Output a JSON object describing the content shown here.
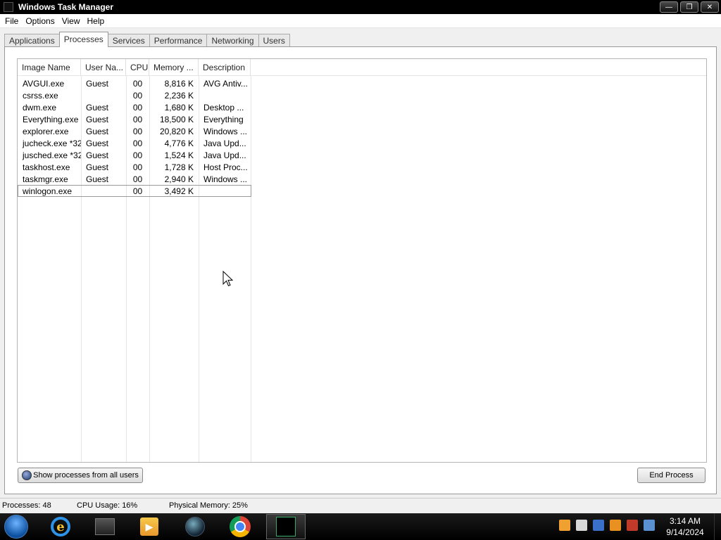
{
  "window": {
    "title": "Windows Task Manager",
    "controls": {
      "minimize": "—",
      "restore": "❐",
      "close": "✕"
    }
  },
  "menu": [
    "File",
    "Options",
    "View",
    "Help"
  ],
  "tabs": [
    {
      "label": "Applications",
      "active": false
    },
    {
      "label": "Processes",
      "active": true
    },
    {
      "label": "Services",
      "active": false
    },
    {
      "label": "Performance",
      "active": false
    },
    {
      "label": "Networking",
      "active": false
    },
    {
      "label": "Users",
      "active": false
    }
  ],
  "table": {
    "columns": [
      "Image Name",
      "User Na...",
      "CPU",
      "Memory ...",
      "Description"
    ],
    "rows": [
      {
        "image": "AVGUI.exe",
        "user": "Guest",
        "cpu": "00",
        "memory": "8,816 K",
        "description": "AVG Antiv..."
      },
      {
        "image": "csrss.exe",
        "user": "",
        "cpu": "00",
        "memory": "2,236 K",
        "description": ""
      },
      {
        "image": "dwm.exe",
        "user": "Guest",
        "cpu": "00",
        "memory": "1,680 K",
        "description": "Desktop ..."
      },
      {
        "image": "Everything.exe",
        "user": "Guest",
        "cpu": "00",
        "memory": "18,500 K",
        "description": "Everything"
      },
      {
        "image": "explorer.exe",
        "user": "Guest",
        "cpu": "00",
        "memory": "20,820 K",
        "description": "Windows ..."
      },
      {
        "image": "jucheck.exe *32",
        "user": "Guest",
        "cpu": "00",
        "memory": "4,776 K",
        "description": "Java Upd..."
      },
      {
        "image": "jusched.exe *32",
        "user": "Guest",
        "cpu": "00",
        "memory": "1,524 K",
        "description": "Java Upd..."
      },
      {
        "image": "taskhost.exe",
        "user": "Guest",
        "cpu": "00",
        "memory": "1,728 K",
        "description": "Host Proc..."
      },
      {
        "image": "taskmgr.exe",
        "user": "Guest",
        "cpu": "00",
        "memory": "2,940 K",
        "description": "Windows ..."
      },
      {
        "image": "winlogon.exe",
        "user": "",
        "cpu": "00",
        "memory": "3,492 K",
        "description": "",
        "selected": true
      }
    ]
  },
  "buttons": {
    "show_all": "Show processes from all users",
    "end_process": "End Process"
  },
  "status": {
    "processes": "Processes: 48",
    "cpu": "CPU Usage: 16%",
    "memory": "Physical Memory: 25%"
  },
  "taskbar": {
    "pinned": [
      "start-orb-icon",
      "internet-explorer-icon",
      "file-explorer-icon",
      "media-player-icon",
      "globe-icon",
      "chrome-icon",
      "task-manager-icon"
    ],
    "tray": [
      {
        "name": "orange-tray-icon",
        "color": "#f0a030"
      },
      {
        "name": "notes-tray-icon",
        "color": "#d8d8d8"
      },
      {
        "name": "shield-tray-icon",
        "color": "#3a70c8"
      },
      {
        "name": "search-tray-icon",
        "color": "#e89020"
      },
      {
        "name": "flag-tray-icon",
        "color": "#c03a2a"
      },
      {
        "name": "network-tray-icon",
        "color": "#5a90d0"
      }
    ],
    "time": "3:14 AM",
    "date": "9/14/2024"
  }
}
